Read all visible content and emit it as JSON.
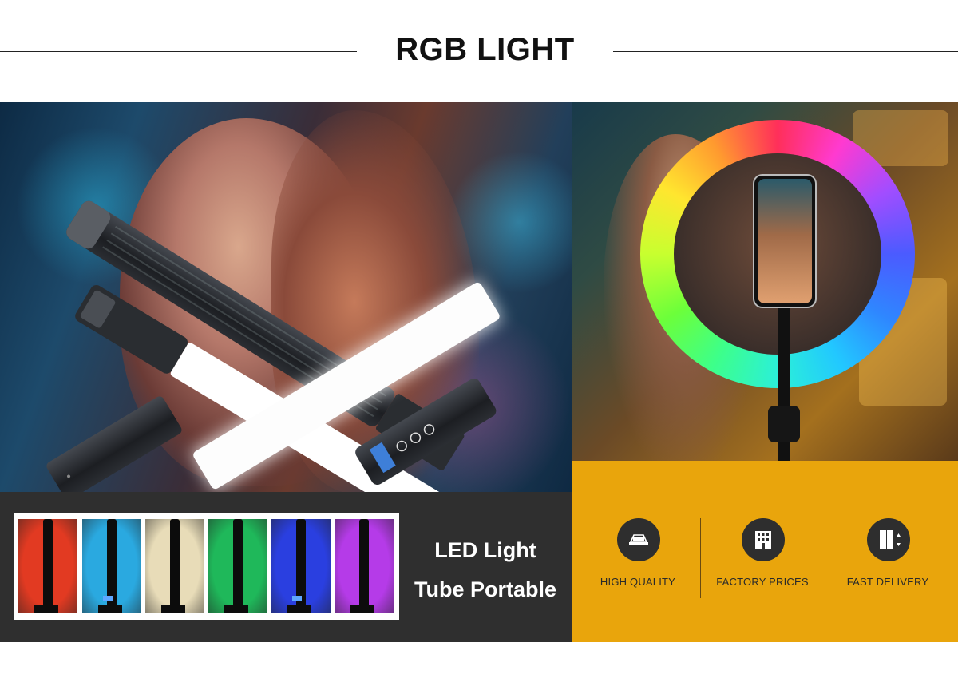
{
  "header": {
    "title": "RGB LIGHT"
  },
  "bottom_left": {
    "caption_line1": "LED Light",
    "caption_line2": "Tube Portable",
    "swatch_colors": [
      "#e23a22",
      "#2aa9e0",
      "#e8dcb8",
      "#1fb85a",
      "#2a3fe0",
      "#b53be8"
    ]
  },
  "features": [
    {
      "icon": "taxi-sign-icon",
      "label": "HIGH QUALITY"
    },
    {
      "icon": "building-icon",
      "label": "FACTORY PRICES"
    },
    {
      "icon": "door-arrows-icon",
      "label": "FAST DELIVERY"
    }
  ],
  "colors": {
    "accent_orange": "#e9a50c",
    "dark_panel": "#2f2f2f",
    "icon_circle": "#2e2e2e"
  }
}
